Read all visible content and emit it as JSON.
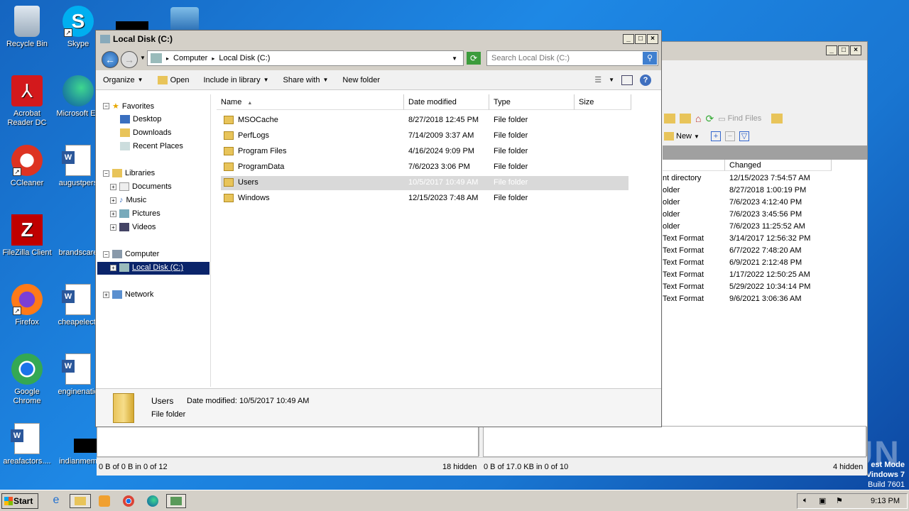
{
  "desktop": {
    "icons": [
      {
        "label": "Recycle Bin"
      },
      {
        "label": "Skype"
      },
      {
        "label": "Acrobat Reader DC"
      },
      {
        "label": "Microsoft Ed"
      },
      {
        "label": "CCleaner"
      },
      {
        "label": "augustpers"
      },
      {
        "label": "FileZilla Client"
      },
      {
        "label": "brandscare"
      },
      {
        "label": "Firefox"
      },
      {
        "label": "cheapelectr"
      },
      {
        "label": "Google Chrome"
      },
      {
        "label": "enginenatio"
      },
      {
        "label": "areafactors...."
      },
      {
        "label": "indianmem"
      }
    ],
    "watermark": "ANY RUN",
    "test_mode": {
      "line1": "est Mode",
      "line2": "Vindows 7",
      "line3": "Build 7601"
    }
  },
  "back_window": {
    "toolbar": {
      "find_files": "Find Files",
      "new_label": "New"
    },
    "col_changed": "Changed",
    "rows": [
      {
        "type": "nt directory",
        "changed": "12/15/2023 7:54:57 AM"
      },
      {
        "type": "older",
        "changed": "8/27/2018 1:00:19 PM"
      },
      {
        "type": "older",
        "changed": "7/6/2023 4:12:40 PM"
      },
      {
        "type": "older",
        "changed": "7/6/2023 3:45:56 PM"
      },
      {
        "type": "older",
        "changed": "7/6/2023 11:25:52 AM"
      },
      {
        "type": "Text Format",
        "changed": "3/14/2017 12:56:32 PM"
      },
      {
        "type": "Text Format",
        "changed": "6/7/2022 7:48:20 AM"
      },
      {
        "type": "Text Format",
        "changed": "6/9/2021 2:12:48 PM"
      },
      {
        "type": "Text Format",
        "changed": "1/17/2022 12:50:25 AM"
      },
      {
        "type": "Text Format",
        "changed": "5/29/2022 10:34:14 PM"
      },
      {
        "type": "Text Format",
        "changed": "9/6/2021 3:06:36 AM"
      }
    ],
    "status_left": "0 B of 0 B in 0 of 12",
    "status_mid_hidden": "18 hidden",
    "status_right": "0 B of 17.0 KB in 0 of 10",
    "status_right_hidden": "4 hidden"
  },
  "explorer": {
    "title": "Local Disk (C:)",
    "breadcrumb": [
      "Computer",
      "Local Disk (C:)"
    ],
    "search_placeholder": "Search Local Disk (C:)",
    "commands": {
      "organize": "Organize",
      "open": "Open",
      "include": "Include in library",
      "share": "Share with",
      "new_folder": "New folder"
    },
    "nav": {
      "favorites": "Favorites",
      "desktop": "Desktop",
      "downloads": "Downloads",
      "recent": "Recent Places",
      "libraries": "Libraries",
      "documents": "Documents",
      "music": "Music",
      "pictures": "Pictures",
      "videos": "Videos",
      "computer": "Computer",
      "local_disk": "Local Disk (C:)",
      "network": "Network"
    },
    "columns": {
      "name": "Name",
      "date": "Date modified",
      "type": "Type",
      "size": "Size"
    },
    "files": [
      {
        "name": "MSOCache",
        "date": "8/27/2018 12:45 PM",
        "type": "File folder"
      },
      {
        "name": "PerfLogs",
        "date": "7/14/2009 3:37 AM",
        "type": "File folder"
      },
      {
        "name": "Program Files",
        "date": "4/16/2024 9:09 PM",
        "type": "File folder"
      },
      {
        "name": "ProgramData",
        "date": "7/6/2023 3:06 PM",
        "type": "File folder"
      },
      {
        "name": "Users",
        "date": "10/5/2017 10:49 AM",
        "type": "File folder"
      },
      {
        "name": "Windows",
        "date": "12/15/2023 7:48 AM",
        "type": "File folder"
      }
    ],
    "details": {
      "name": "Users",
      "modified_label": "Date modified:",
      "modified": "10/5/2017 10:49 AM",
      "kind": "File folder"
    }
  },
  "taskbar": {
    "start": "Start",
    "time": "9:13 PM"
  }
}
